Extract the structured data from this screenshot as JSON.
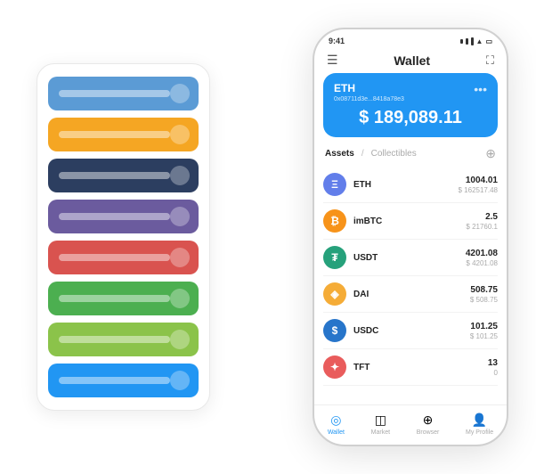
{
  "app": {
    "title": "Wallet"
  },
  "phone": {
    "status_time": "9:41",
    "header_title": "Wallet",
    "eth_card": {
      "symbol": "ETH",
      "address": "0x08711d3e...8418a78e3",
      "balance": "$ 189,089.11"
    },
    "assets_tab": "Assets",
    "collectibles_tab": "Collectibles",
    "assets": [
      {
        "name": "ETH",
        "amount": "1004.01",
        "usd": "$ 162517.48",
        "color": "#627EEA",
        "symbol": "Ξ"
      },
      {
        "name": "imBTC",
        "amount": "2.5",
        "usd": "$ 21760.1",
        "color": "#F7931A",
        "symbol": "₿"
      },
      {
        "name": "USDT",
        "amount": "4201.08",
        "usd": "$ 4201.08",
        "color": "#26A17B",
        "symbol": "₮"
      },
      {
        "name": "DAI",
        "amount": "508.75",
        "usd": "$ 508.75",
        "color": "#F5AC37",
        "symbol": "◈"
      },
      {
        "name": "USDC",
        "amount": "101.25",
        "usd": "$ 101.25",
        "color": "#2775CA",
        "symbol": "$"
      },
      {
        "name": "TFT",
        "amount": "13",
        "usd": "0",
        "color": "#E95C5C",
        "symbol": "✦"
      }
    ],
    "nav": [
      {
        "label": "Wallet",
        "icon": "◎",
        "active": true
      },
      {
        "label": "Market",
        "icon": "◫",
        "active": false
      },
      {
        "label": "Browser",
        "icon": "⊕",
        "active": false
      },
      {
        "label": "My Profile",
        "icon": "👤",
        "active": false
      }
    ]
  },
  "bg_card": {
    "strips": [
      {
        "color": "#5B9BD5"
      },
      {
        "color": "#F5A623"
      },
      {
        "color": "#2C3E60"
      },
      {
        "color": "#6B5B9E"
      },
      {
        "color": "#D9534F"
      },
      {
        "color": "#4CAF50"
      },
      {
        "color": "#8BC34A"
      },
      {
        "color": "#2196F3"
      }
    ]
  }
}
